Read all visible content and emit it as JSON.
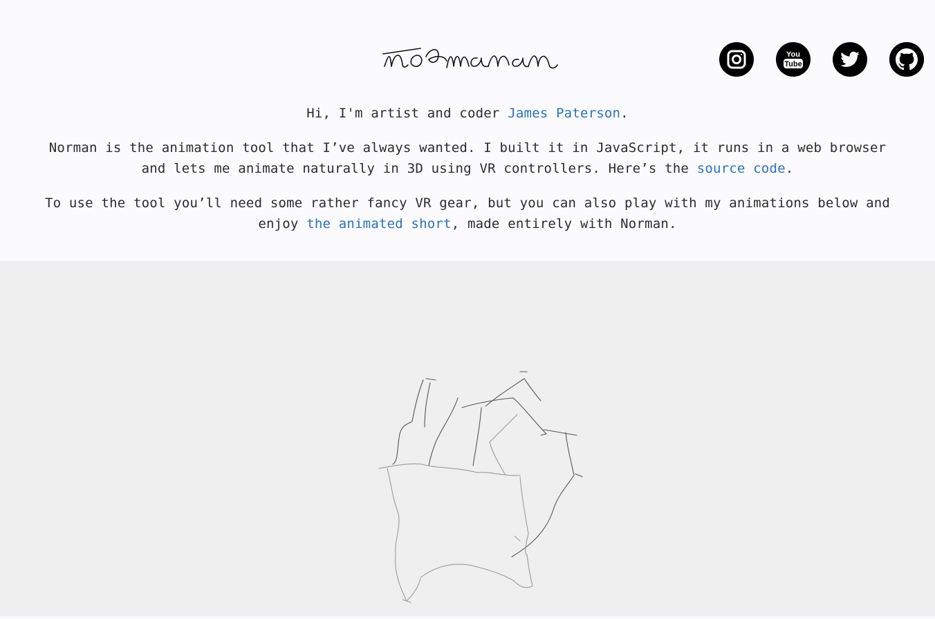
{
  "logo": {
    "text": "norman"
  },
  "socials": [
    {
      "name": "instagram-icon",
      "label": "Instagram"
    },
    {
      "name": "youtube-icon",
      "label": "YouTube",
      "line1": "You",
      "line2": "Tube"
    },
    {
      "name": "twitter-icon",
      "label": "Twitter"
    },
    {
      "name": "github-icon",
      "label": "GitHub"
    }
  ],
  "intro": {
    "p1": {
      "before": "Hi, I'm artist and coder ",
      "link": "James Paterson",
      "after": "."
    },
    "p2": {
      "before": "Norman is the animation tool that I’ve always wanted. I built it in JavaScript, it runs in a web browser and lets me animate naturally in 3D using VR controllers. Here’s the ",
      "link": "source code",
      "after": "."
    },
    "p3": {
      "before": "To use the tool you’ll need some rather fancy VR gear, but you can also play with my animations below and enjoy ",
      "link": "the animated short",
      "after": ", made entirely with Norman."
    }
  },
  "colors": {
    "link": "#2b72b8",
    "text": "#2b2b2b",
    "header_bg": "#fbfbfe",
    "canvas_bg": "#efefef"
  }
}
